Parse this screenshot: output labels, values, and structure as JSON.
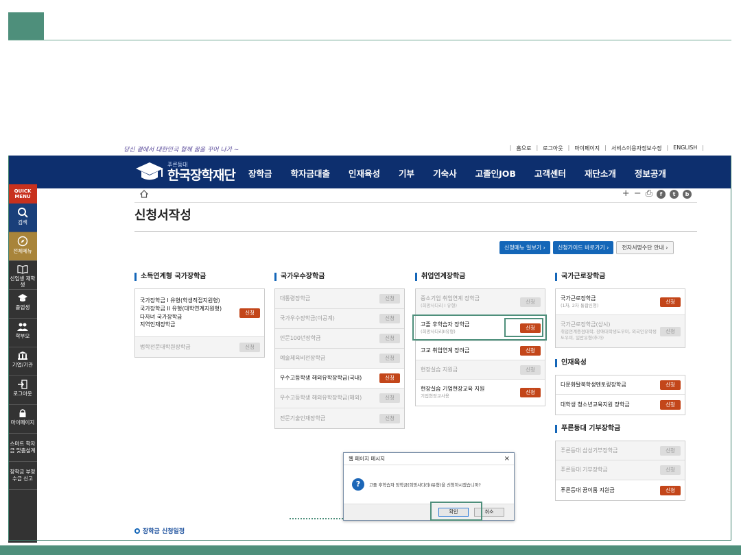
{
  "topbar": {
    "slogan": "당신 곁에서 대한민국 함께 꿈을 꾸어 나가 ~",
    "links": [
      "홈으로",
      "로그아웃",
      "마이페이지",
      "서비스이용자정보수정",
      "ENGLISH"
    ]
  },
  "header": {
    "logo_small": "푸른등대",
    "logo_big": "한국장학재단",
    "nav": [
      "장학금",
      "학자금대출",
      "인재육성",
      "기부",
      "기숙사",
      "고졸인JOB",
      "고객센터",
      "재단소개",
      "정보공개"
    ]
  },
  "quick_menu": {
    "head": "QUICK MENU",
    "items": [
      "검색",
      "전체메뉴",
      "신입생 재학생",
      "졸업생",
      "학부모",
      "기업/기관",
      "로그아웃",
      "마이페이지"
    ],
    "text_items": [
      "스마트 학자금 맞춤설계",
      "장학금 부정수급 신고"
    ]
  },
  "toolbar": {
    "plus": "+",
    "minus": "−",
    "print": "⎙",
    "share_f": "f",
    "share_t": "t",
    "share_b": "b"
  },
  "page_title": "신청서작성",
  "guide_buttons": [
    "신청메뉴 일보기 ›",
    "신청가이드 바로가기 ›",
    "전자서명수단 안내 ›"
  ],
  "columns": {
    "c1": {
      "title": "소득연계형 국가장학금",
      "group": [
        "국가장학금 I 유형(학생직접지원형)",
        "국가장학금 II 유형(대학연계지원형)",
        "다자녀 국가장학금",
        "지역인재장학금"
      ],
      "rows": [
        {
          "label": "법학전문대학원장학금",
          "btn": "신청"
        }
      ],
      "group_btn": "신청"
    },
    "c2": {
      "title": "국가우수장학금",
      "rows": [
        {
          "label": "대통령장학금",
          "btn": "신청"
        },
        {
          "label": "국가우수장학금(이공계)",
          "btn": "신청"
        },
        {
          "label": "인문100년장학금",
          "btn": "신청"
        },
        {
          "label": "예술체육비전장학금",
          "btn": "신청"
        },
        {
          "label": "우수고등학생 해외유학장학금(국내)",
          "btn": "신청"
        },
        {
          "label": "우수고등학생 해외유학장학금(해외)",
          "btn": "신청"
        },
        {
          "label": "전문기술인재장학금",
          "btn": "신청"
        }
      ]
    },
    "c3": {
      "title": "취업연계장학금",
      "rows": [
        {
          "label": "중소기업 취업연계 장학금",
          "sub": "(희망사다리 I 유형)",
          "btn": "신청"
        },
        {
          "label": "고졸 후학습자 장학금",
          "sub": "(희망사다리II유형)",
          "btn": "신청"
        },
        {
          "label": "고교 취업연계 장려금",
          "btn": "신청"
        },
        {
          "label": "현장실습 지원금",
          "btn": "신청"
        },
        {
          "label": "현장실습 기업현장교육 지원",
          "sub": "기업현장교사용",
          "btn": "신청"
        }
      ]
    },
    "c4a": {
      "title": "국가근로장학금",
      "rows": [
        {
          "label": "국가근로장학금",
          "sub": "(1차, 2차 통합신청)",
          "btn": "신청"
        },
        {
          "label": "국가근로장학금(상시)",
          "sub": "취업연계중점대학, 장애대학생도우미, 외국인유학생도우미, 일반유형(추가)",
          "btn": "신청"
        }
      ]
    },
    "c4b": {
      "title": "인재육성",
      "rows": [
        {
          "label": "다문화탈북학생멘토링장학금",
          "btn": "신청"
        },
        {
          "label": "대학생 청소년교육지원 장학금",
          "btn": "신청"
        }
      ]
    },
    "c4c": {
      "title": "푸른등대 기부장학금",
      "rows": [
        {
          "label": "푸른등대 삼성기부장학금",
          "btn": "신청"
        },
        {
          "label": "푸른등대 기부장학금",
          "btn": "신청"
        },
        {
          "label": "푸른등대 꿈이룸 지원금",
          "btn": "신청"
        }
      ]
    }
  },
  "dialog": {
    "title": "웹 페이지 메시지",
    "close": "×",
    "icon": "?",
    "message": "고졸 후학습자 장학금(희망사다리II유형)을 신청하시겠습니까?",
    "ok": "확인",
    "cancel": "취소"
  },
  "schedule_link": "장학금 신청일정"
}
